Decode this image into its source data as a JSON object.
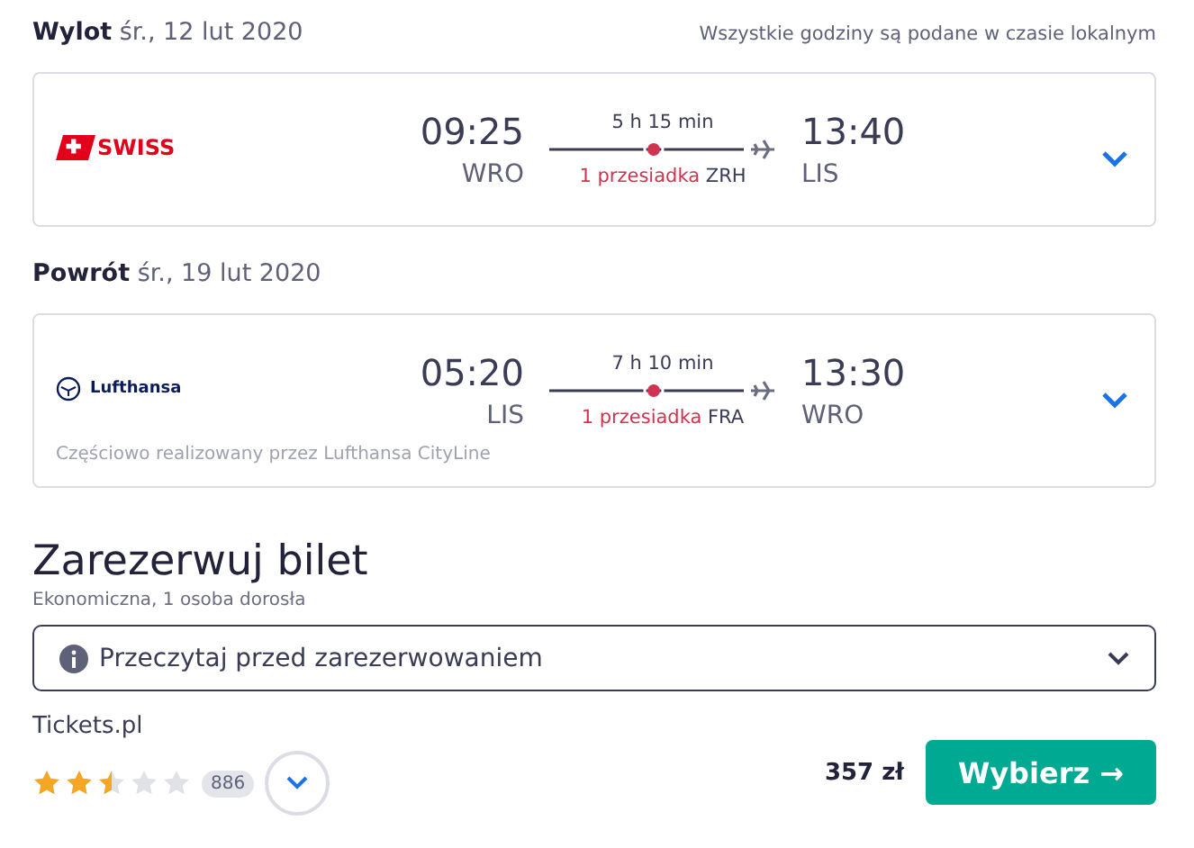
{
  "legs": [
    {
      "direction": "Wylot",
      "date": "śr., 12 lut 2020",
      "note": "Wszystkie godziny są podane w czasie lokalnym",
      "airline": {
        "kind": "swiss",
        "name": "SWISS"
      },
      "depart_time": "09:25",
      "depart_airport": "WRO",
      "duration": "5 h 15 min",
      "stops": "1 przesiadka",
      "stop_airport": "ZRH",
      "arrive_time": "13:40",
      "arrive_airport": "LIS"
    },
    {
      "direction": "Powrót",
      "date": "śr., 19 lut 2020",
      "airline": {
        "kind": "lufthansa",
        "name": "Lufthansa"
      },
      "depart_time": "05:20",
      "depart_airport": "LIS",
      "duration": "7 h 10 min",
      "stops": "1 przesiadka",
      "stop_airport": "FRA",
      "arrive_time": "13:30",
      "arrive_airport": "WRO",
      "operated_by": "Częściowo realizowany przez Lufthansa CityLine"
    }
  ],
  "booking": {
    "title": "Zarezerwuj bilet",
    "subtitle": "Ekonomiczna, 1 osoba dorosła",
    "info_dropdown": "Przeczytaj przed zarezerwowaniem",
    "provider": "Tickets.pl",
    "stars": 2.5,
    "reviews": "886",
    "price": "357 zł",
    "button": "Wybierz →"
  }
}
